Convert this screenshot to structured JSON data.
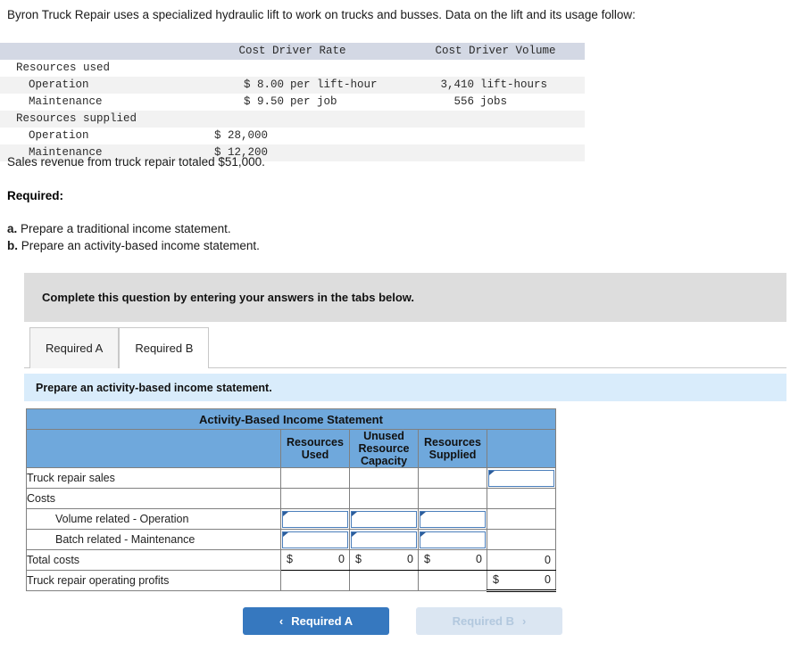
{
  "intro": "Byron Truck Repair uses a specialized hydraulic lift to work on trucks and busses. Data on the lift and its usage follow:",
  "data_table": {
    "headers": [
      "",
      "Cost Driver Rate",
      "Cost Driver Volume"
    ],
    "rows": [
      {
        "label": "Resources used",
        "indent": 1,
        "rate_num": "",
        "rate_unit": "",
        "vol_num": "",
        "vol_unit": ""
      },
      {
        "label": "Operation",
        "indent": 2,
        "rate_num": "$ 8.00",
        "rate_unit": "per lift-hour",
        "vol_num": "3,410",
        "vol_unit": "lift-hours"
      },
      {
        "label": "Maintenance",
        "indent": 2,
        "rate_num": "$ 9.50",
        "rate_unit": "per job",
        "vol_num": "556",
        "vol_unit": "jobs"
      },
      {
        "label": "Resources supplied",
        "indent": 1,
        "rate_num": "",
        "rate_unit": "",
        "vol_num": "",
        "vol_unit": ""
      },
      {
        "label": "Operation",
        "indent": 2,
        "rate_num": "$ 28,000",
        "rate_unit": "",
        "vol_num": "",
        "vol_unit": ""
      },
      {
        "label": "Maintenance",
        "indent": 2,
        "rate_num": "$ 12,200",
        "rate_unit": "",
        "vol_num": "",
        "vol_unit": ""
      }
    ]
  },
  "sales_line": "Sales revenue from truck repair totaled $51,000.",
  "required_heading": "Required:",
  "requirements": {
    "a_letter": "a.",
    "a_text": " Prepare a traditional income statement.",
    "b_letter": "b.",
    "b_text": " Prepare an activity-based income statement."
  },
  "grey_banner": "Complete this question by entering your answers in the tabs below.",
  "tabs": [
    {
      "label": "Required A",
      "active": false
    },
    {
      "label": "Required B",
      "active": true
    }
  ],
  "blue_bar": "Prepare an activity-based income statement.",
  "statement": {
    "title": "Activity-Based Income Statement",
    "columns": [
      "",
      "Resources Used",
      "Unused Resource Capacity",
      "Resources Supplied",
      ""
    ],
    "rows": [
      {
        "label": "Truck repair sales",
        "indent": false
      },
      {
        "label": "Costs",
        "indent": false
      },
      {
        "label": "Volume related - Operation",
        "indent": true
      },
      {
        "label": "Batch related - Maintenance",
        "indent": true
      },
      {
        "label": "Total costs",
        "indent": false
      },
      {
        "label": "Truck repair operating profits",
        "indent": false
      }
    ],
    "inputs": {
      "sales_total": "",
      "operation_ru": "",
      "operation_urc": "",
      "operation_rs": "",
      "maintenance_ru": "",
      "maintenance_urc": "",
      "maintenance_rs": ""
    },
    "totals": {
      "dollar": "$",
      "total_ru": "0",
      "total_urc": "0",
      "total_rs": "0",
      "total_col": "0",
      "profit": "0"
    }
  },
  "nav": {
    "prev_label": "Required A",
    "prev_chevron": "‹",
    "next_label": "Required B",
    "next_chevron": "›"
  },
  "colors": {
    "table_header_blue": "#6fa8dc",
    "banner_grey": "#dddddd",
    "bar_blue": "#d9ecfb",
    "button_blue": "#3678bf",
    "button_disabled": "#dbe6f2",
    "input_border": "#4a7ebb"
  }
}
